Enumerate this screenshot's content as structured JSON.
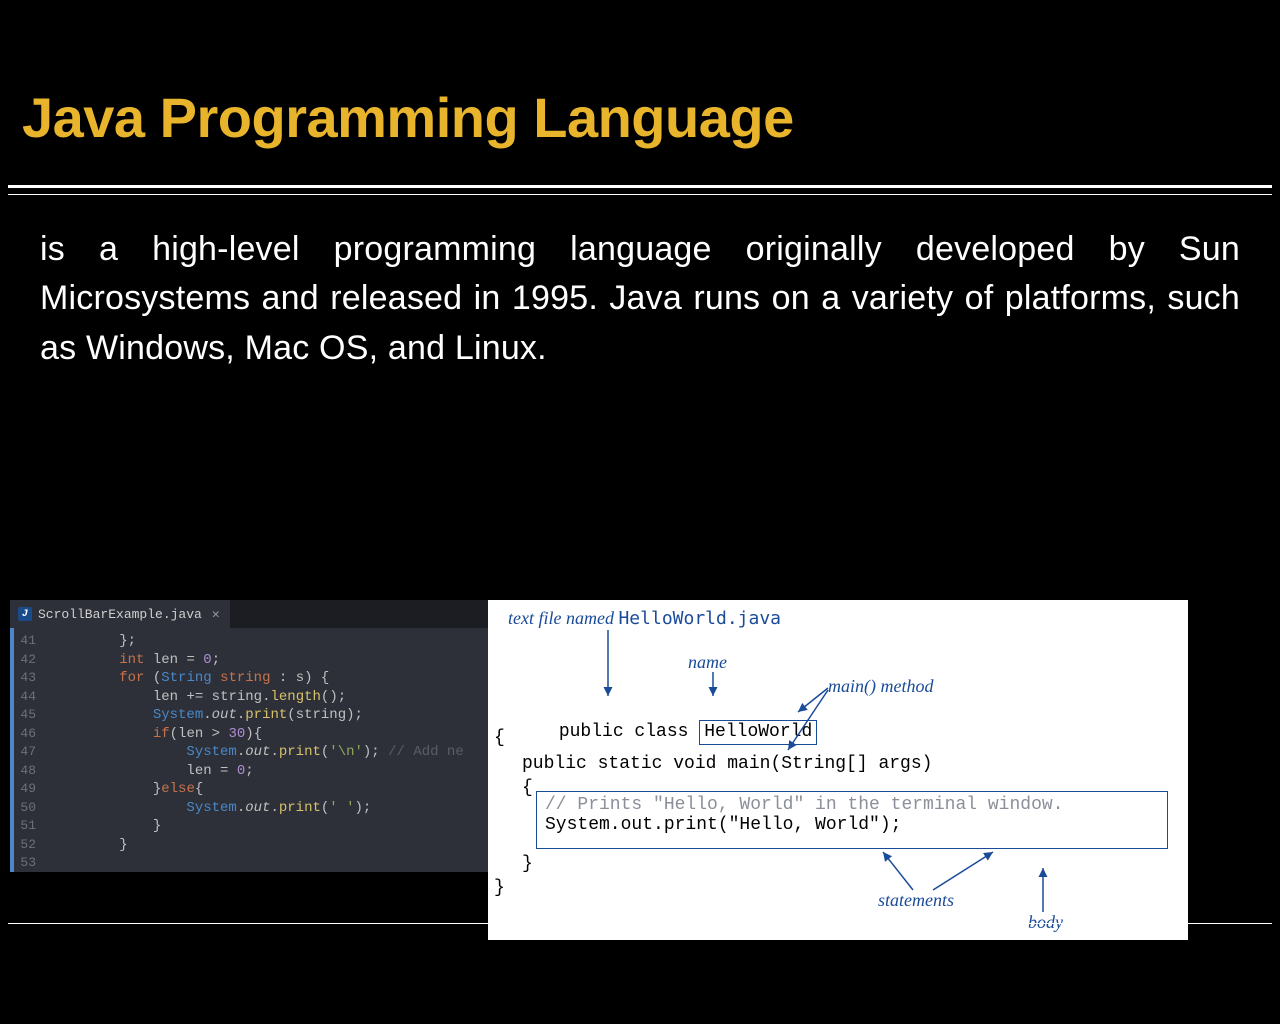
{
  "title": "Java Programming Language",
  "body": "is a high-level programming language originally developed by Sun Microsystems and released in 1995. Java runs on a variety of platforms, such as Windows, Mac OS, and Linux.",
  "editor": {
    "tab_name": "ScrollBarExample.java",
    "line_start": 41,
    "line_end": 53,
    "code_lines": [
      {
        "indent": 2,
        "tokens": [
          [
            "punc",
            "};"
          ]
        ]
      },
      {
        "indent": 2,
        "tokens": [
          [
            "kw",
            "int"
          ],
          [
            "sp",
            " "
          ],
          [
            "id",
            "len"
          ],
          [
            "sp",
            " "
          ],
          [
            "punc",
            "= "
          ],
          [
            "num",
            "0"
          ],
          [
            "punc",
            ";"
          ]
        ]
      },
      {
        "indent": 2,
        "tokens": [
          [
            "kw",
            "for"
          ],
          [
            "sp",
            " "
          ],
          [
            "punc",
            "("
          ],
          [
            "type",
            "String"
          ],
          [
            "sp",
            " "
          ],
          [
            "var",
            "string"
          ],
          [
            "sp",
            " "
          ],
          [
            "punc",
            ": "
          ],
          [
            "id",
            "s"
          ],
          [
            "punc",
            ") {"
          ]
        ]
      },
      {
        "indent": 3,
        "tokens": [
          [
            "id",
            "len"
          ],
          [
            "sp",
            " "
          ],
          [
            "punc",
            "+= "
          ],
          [
            "id",
            "string"
          ],
          [
            "punc",
            "."
          ],
          [
            "meth",
            "length"
          ],
          [
            "punc",
            "();"
          ]
        ]
      },
      {
        "indent": 3,
        "tokens": [
          [
            "type",
            "System"
          ],
          [
            "punc",
            "."
          ],
          [
            "fld",
            "out"
          ],
          [
            "punc",
            "."
          ],
          [
            "meth",
            "print"
          ],
          [
            "punc",
            "("
          ],
          [
            "id",
            "string"
          ],
          [
            "punc",
            ");"
          ]
        ]
      },
      {
        "indent": 3,
        "tokens": [
          [
            "kw",
            "if"
          ],
          [
            "punc",
            "("
          ],
          [
            "id",
            "len"
          ],
          [
            "sp",
            " "
          ],
          [
            "punc",
            "> "
          ],
          [
            "num",
            "30"
          ],
          [
            "punc",
            "){"
          ]
        ]
      },
      {
        "indent": 4,
        "tokens": [
          [
            "type",
            "System"
          ],
          [
            "punc",
            "."
          ],
          [
            "fld",
            "out"
          ],
          [
            "punc",
            "."
          ],
          [
            "meth",
            "print"
          ],
          [
            "punc",
            "("
          ],
          [
            "str",
            "'\\n'"
          ],
          [
            "punc",
            ");"
          ],
          [
            "sp",
            " "
          ],
          [
            "com",
            "// Add ne"
          ]
        ]
      },
      {
        "indent": 4,
        "tokens": [
          [
            "id",
            "len"
          ],
          [
            "sp",
            " "
          ],
          [
            "punc",
            "= "
          ],
          [
            "num",
            "0"
          ],
          [
            "punc",
            ";"
          ]
        ]
      },
      {
        "indent": 3,
        "tokens": [
          [
            "punc",
            "}"
          ],
          [
            "kw",
            "else"
          ],
          [
            "punc",
            "{"
          ]
        ]
      },
      {
        "indent": 4,
        "tokens": [
          [
            "type",
            "System"
          ],
          [
            "punc",
            "."
          ],
          [
            "fld",
            "out"
          ],
          [
            "punc",
            "."
          ],
          [
            "meth",
            "print"
          ],
          [
            "punc",
            "("
          ],
          [
            "str",
            "' '"
          ],
          [
            "punc",
            ");"
          ]
        ]
      },
      {
        "indent": 3,
        "tokens": [
          [
            "punc",
            "}"
          ]
        ]
      },
      {
        "indent": 2,
        "tokens": [
          [
            "punc",
            "}"
          ]
        ]
      },
      {
        "indent": 0,
        "tokens": []
      }
    ]
  },
  "diagram": {
    "label_file_prefix": "text file named ",
    "label_file_name": "HelloWorld.java",
    "label_name": "name",
    "label_main": "main() method",
    "label_statements": "statements",
    "label_body": "body",
    "class_decl_pre": "public class",
    "class_name": "HelloWorld",
    "brace_open": "{",
    "main_sig": "public static void main(String[] args)",
    "inner_brace_open": "{",
    "comment": "// Prints \"Hello, World\" in the terminal window.",
    "stmt": "System.out.print(\"Hello, World\");",
    "inner_brace_close": "}",
    "brace_close": "}"
  }
}
